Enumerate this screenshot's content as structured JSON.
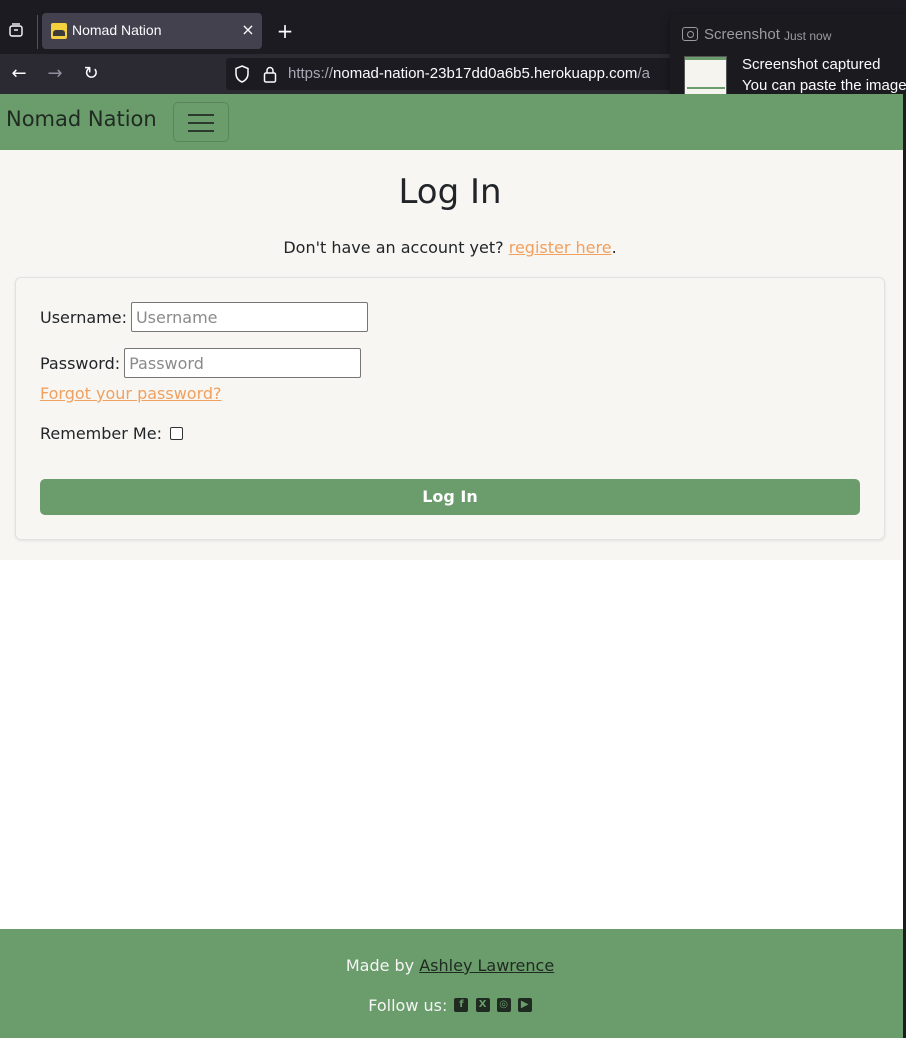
{
  "browser": {
    "tab_title": "Nomad Nation",
    "tab_close": "×",
    "new_tab": "+",
    "back": "←",
    "forward": "→",
    "reload": "↻",
    "url_host": "https://nomad-nation-23b17dd0a6b5.herokuapp.com/a",
    "url_prefix_dim": "https://",
    "url_main": "nomad-nation-23b17dd0a6b5.herokuapp.com",
    "url_suffix_dim": "/a"
  },
  "notification": {
    "app": "Screenshot",
    "time": "Just now",
    "line1": "Screenshot captured",
    "line2": "You can paste the image"
  },
  "site": {
    "brand": "Nomad Nation"
  },
  "login": {
    "title": "Log In",
    "register_prefix": "Don't have an account yet? ",
    "register_link": "register here",
    "register_suffix": ".",
    "username_label": "Username:",
    "username_placeholder": "Username",
    "password_label": "Password:",
    "password_placeholder": "Password",
    "forgot_link": "Forgot your password?",
    "remember_label": "Remember Me:",
    "submit_label": "Log In"
  },
  "footer": {
    "made_by_prefix": "Made by ",
    "author": "Ashley Lawrence",
    "follow_label": "Follow us:",
    "social": [
      "facebook-icon",
      "x-icon",
      "instagram-icon",
      "youtube-icon"
    ]
  },
  "colors": {
    "brand_green": "#6a9c6c",
    "link_orange": "#f0a05f",
    "page_bg": "#f8f6f2"
  }
}
